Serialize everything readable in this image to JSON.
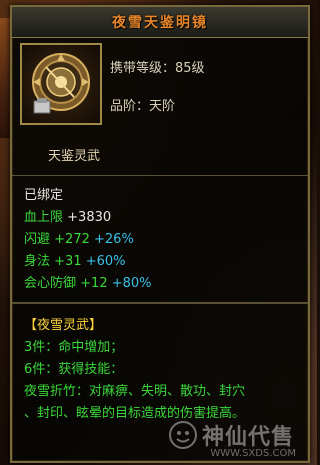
{
  "item": {
    "title": "夜雪天鉴明镜",
    "carry_level": "携带等级：85级",
    "rank": "品阶：天阶",
    "name": "天鉴灵武",
    "bound": "已绑定"
  },
  "stats": [
    {
      "label": "血上限",
      "value": "+3830",
      "extra": ""
    },
    {
      "label": "闪避",
      "value": "+272",
      "extra": "+26%"
    },
    {
      "label": "身法",
      "value": "+31",
      "extra": "+60%"
    },
    {
      "label": "会心防御",
      "value": "+12",
      "extra": "+80%"
    }
  ],
  "set": {
    "name": "【夜雪灵武】",
    "bonus3": "3件：命中增加；",
    "bonus6": "6件：获得技能：",
    "skill_line1": "夜雪折竹：对麻痹、失明、散功、封穴",
    "skill_line2": "、封印、眩晕的目标造成的伤害提高。"
  },
  "watermark": {
    "text": "神仙代售",
    "sub": "WWW.SXDS.COM"
  },
  "colors": {
    "title": "#e8862a",
    "set_text": "#3ad83a",
    "percent": "#3ac0e8",
    "set_name": "#ffd43a"
  }
}
